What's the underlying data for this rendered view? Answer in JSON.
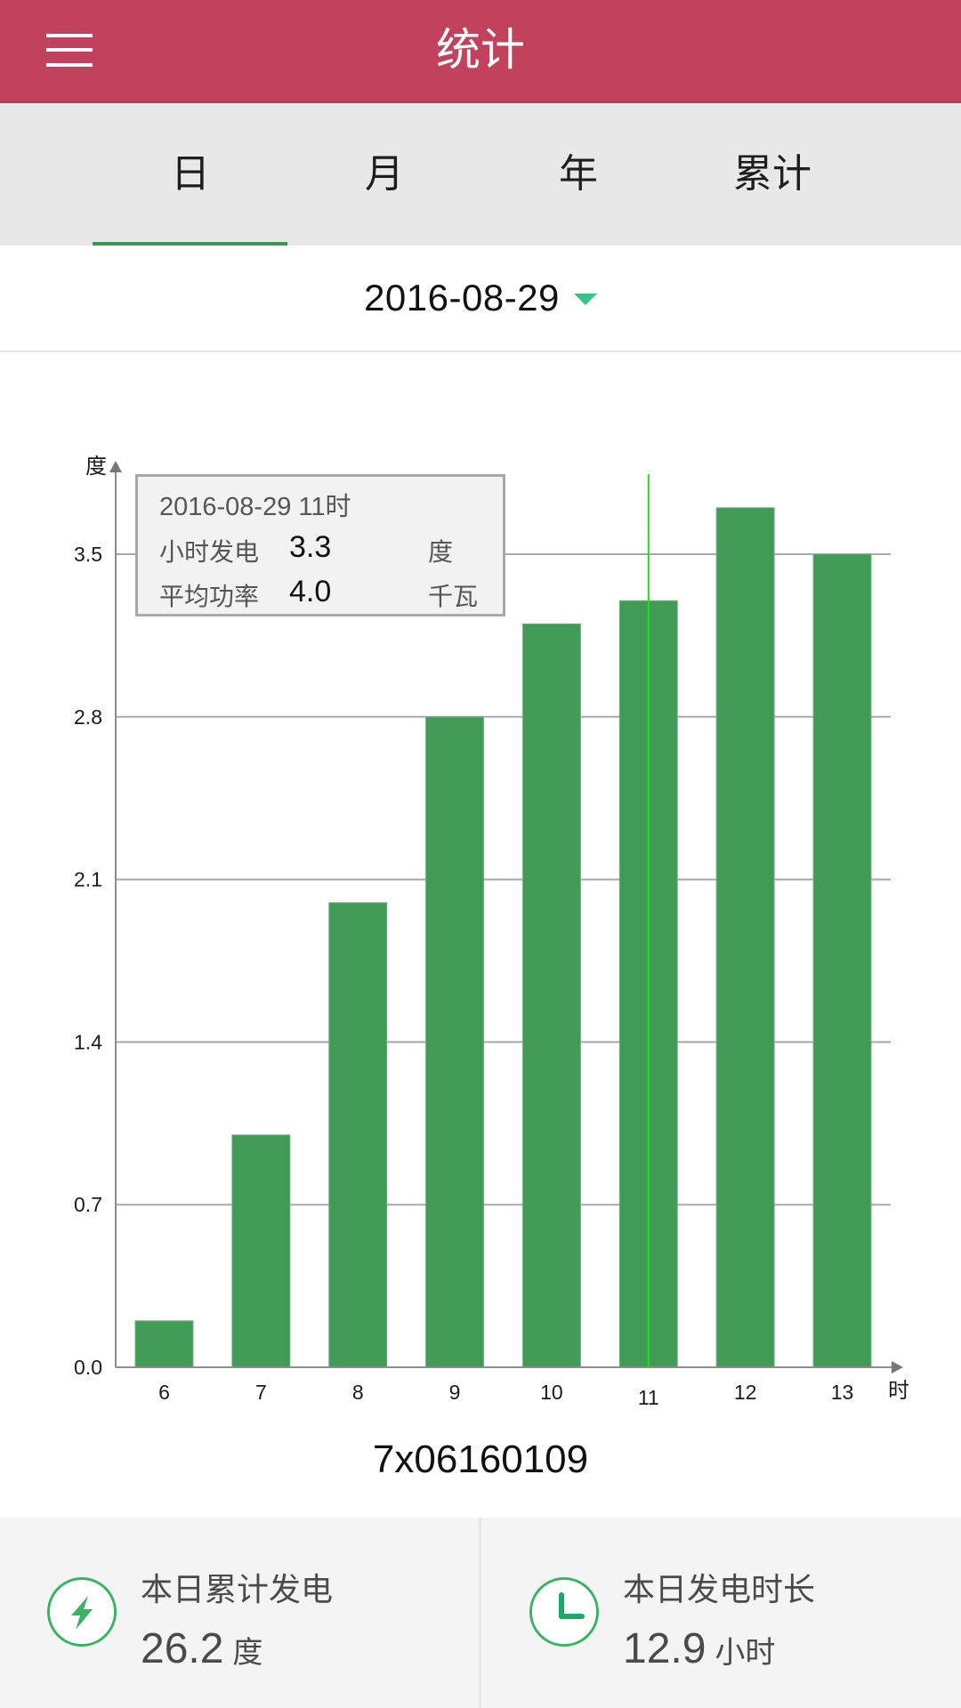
{
  "header": {
    "title": "统计",
    "menu_icon": "hamburger-menu-icon",
    "color": "#c0425c"
  },
  "tabs": [
    {
      "label": "日",
      "active": true
    },
    {
      "label": "月",
      "active": false
    },
    {
      "label": "年",
      "active": false
    },
    {
      "label": "累计",
      "active": false
    }
  ],
  "date_picker": {
    "value": "2016-08-29",
    "icon": "caret-down-icon"
  },
  "tooltip": {
    "title": "2016-08-29 11时",
    "rows": [
      {
        "label": "小时发电",
        "value": "3.3",
        "unit": "度"
      },
      {
        "label": "平均功率",
        "value": "4.0",
        "unit": "千瓦"
      }
    ]
  },
  "chart_data": {
    "type": "bar",
    "title": "",
    "xlabel": "时",
    "ylabel": "度",
    "categories": [
      "6",
      "7",
      "8",
      "9",
      "10",
      "11",
      "12",
      "13"
    ],
    "values": [
      0.2,
      1.0,
      2.0,
      2.8,
      3.2,
      3.3,
      3.7,
      3.5
    ],
    "yticks": [
      "0.0",
      "0.7",
      "1.4",
      "2.1",
      "2.8",
      "3.5"
    ],
    "ylim": [
      0,
      3.5
    ],
    "grid": true,
    "highlighted_category": "11",
    "bar_color": "#429a57",
    "highlight_color": "#22dd22"
  },
  "device_id": "7x06160109",
  "footer": {
    "stats": [
      {
        "label": "本日累计发电",
        "value": "26.2",
        "unit": "度",
        "icon": "lightning-bolt-icon"
      },
      {
        "label": "本日发电时长",
        "value": "12.9",
        "unit": "小时",
        "icon": "clock-icon"
      }
    ]
  }
}
